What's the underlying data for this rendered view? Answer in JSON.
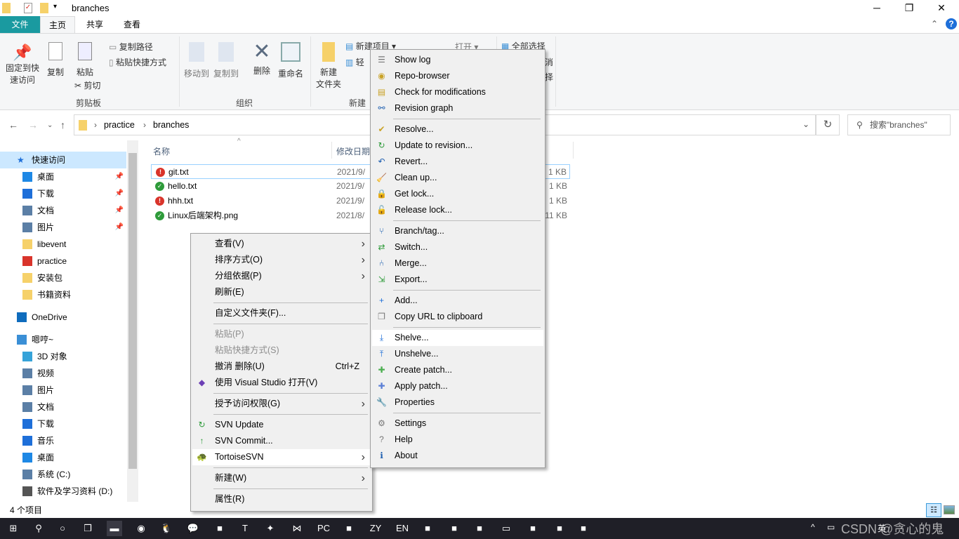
{
  "window": {
    "title": "branches",
    "minimize": "─",
    "maximize": "❐",
    "close": "✕",
    "help": "?",
    "collapse": "⌃"
  },
  "tabs": [
    {
      "label": "文件"
    },
    {
      "label": "主页"
    },
    {
      "label": "共享"
    },
    {
      "label": "查看"
    }
  ],
  "ribbon": {
    "pin": "固定到快",
    "pin2": "速访问",
    "copy": "复制",
    "paste": "粘贴",
    "copy_path": "复制路径",
    "paste_shortcut": "粘贴快捷方式",
    "cut": "剪切",
    "clipboard_group": "剪贴板",
    "move_to": "移动到",
    "copy_to": "复制到",
    "delete": "删除",
    "rename": "重命名",
    "organize_group": "组织",
    "new_folder": "新建",
    "new_folder2": "文件夹",
    "new_item": "新建项目 ▾",
    "easy_access": "轻",
    "new_group": "新建",
    "open": "打开 ▾",
    "select_all": "全部选择",
    "select_none": "消",
    "invert": "择"
  },
  "address": {
    "crumbs": [
      "practice",
      "branches"
    ],
    "search_placeholder": "搜索\"branches\""
  },
  "sidebar": {
    "items": [
      {
        "label": "快速访问",
        "icon": "star-icon",
        "color": "#1e6fd9"
      },
      {
        "label": "桌面",
        "icon": "desktop-icon",
        "color": "#1e88e5",
        "pinned": true
      },
      {
        "label": "下载",
        "icon": "download-icon",
        "color": "#1e6fd9",
        "pinned": true
      },
      {
        "label": "文档",
        "icon": "document-icon",
        "color": "#5b7fa6",
        "pinned": true
      },
      {
        "label": "图片",
        "icon": "pictures-icon",
        "color": "#5b7fa6",
        "pinned": true
      },
      {
        "label": "libevent",
        "icon": "folder-icon",
        "color": "#f6d16a"
      },
      {
        "label": "practice",
        "icon": "svn-conflict-folder-icon",
        "color": "#d9342b"
      },
      {
        "label": "安装包",
        "icon": "folder-icon",
        "color": "#f6d16a"
      },
      {
        "label": "书籍资料",
        "icon": "folder-icon",
        "color": "#f6d16a"
      },
      {
        "label": "OneDrive",
        "icon": "cloud-icon",
        "color": "#0f6cbd"
      },
      {
        "label": "嗯哼~",
        "icon": "computer-icon",
        "color": "#3a8fd6"
      },
      {
        "label": "3D 对象",
        "icon": "cube-icon",
        "color": "#36a3d9"
      },
      {
        "label": "视频",
        "icon": "video-icon",
        "color": "#5b7fa6"
      },
      {
        "label": "图片",
        "icon": "pictures-icon",
        "color": "#5b7fa6"
      },
      {
        "label": "文档",
        "icon": "document-icon",
        "color": "#5b7fa6"
      },
      {
        "label": "下载",
        "icon": "download-icon",
        "color": "#1e6fd9"
      },
      {
        "label": "音乐",
        "icon": "music-icon",
        "color": "#1e6fd9"
      },
      {
        "label": "桌面",
        "icon": "desktop-icon",
        "color": "#1e88e5"
      },
      {
        "label": "系统 (C:)",
        "icon": "drive-icon",
        "color": "#5b7fa6"
      },
      {
        "label": "软件及学习资料 (D:)",
        "icon": "drive-icon",
        "color": "#555"
      }
    ]
  },
  "files": {
    "columns": {
      "name": "名称",
      "date": "修改日期"
    },
    "rows": [
      {
        "name": "git.txt",
        "date": "2021/9/",
        "size": "1 KB",
        "status": "conflict"
      },
      {
        "name": "hello.txt",
        "date": "2021/9/",
        "size": "1 KB",
        "status": "normal"
      },
      {
        "name": "hhh.txt",
        "date": "2021/9/",
        "size": "1 KB",
        "status": "conflict"
      },
      {
        "name": "Linux后端架构.png",
        "date": "2021/8/",
        "size": "11 KB",
        "status": "normal"
      }
    ]
  },
  "status_bar": {
    "count": "4 个项目"
  },
  "context_menu": {
    "items": [
      {
        "label": "查看(V)",
        "arrow": true
      },
      {
        "label": "排序方式(O)",
        "arrow": true
      },
      {
        "label": "分组依据(P)",
        "arrow": true
      },
      {
        "label": "刷新(E)"
      },
      {
        "sep": true
      },
      {
        "label": "自定义文件夹(F)..."
      },
      {
        "sep": true
      },
      {
        "label": "粘贴(P)",
        "disabled": true
      },
      {
        "label": "粘贴快捷方式(S)",
        "disabled": true
      },
      {
        "label": "撤消 删除(U)",
        "key": "Ctrl+Z"
      },
      {
        "label": "使用 Visual Studio 打开(V)",
        "icon": "visual-studio-icon"
      },
      {
        "sep": true
      },
      {
        "label": "授予访问权限(G)",
        "arrow": true
      },
      {
        "sep": true
      },
      {
        "label": "SVN Update",
        "icon": "svn-update-icon"
      },
      {
        "label": "SVN Commit...",
        "icon": "svn-commit-icon"
      },
      {
        "label": "TortoiseSVN",
        "icon": "tortoisesvn-icon",
        "arrow": true,
        "highlighted": true
      },
      {
        "sep": true
      },
      {
        "label": "新建(W)",
        "arrow": true
      },
      {
        "sep": true
      },
      {
        "label": "属性(R)"
      }
    ]
  },
  "svn_menu": {
    "items": [
      {
        "label": "Show log",
        "icon": "log-icon"
      },
      {
        "label": "Repo-browser",
        "icon": "repo-browser-icon"
      },
      {
        "label": "Check for modifications",
        "icon": "check-modifications-icon"
      },
      {
        "label": "Revision graph",
        "icon": "revision-graph-icon"
      },
      {
        "sep": true
      },
      {
        "label": "Resolve...",
        "icon": "resolve-icon"
      },
      {
        "label": "Update to revision...",
        "icon": "update-icon"
      },
      {
        "label": "Revert...",
        "icon": "revert-icon"
      },
      {
        "label": "Clean up...",
        "icon": "broom-icon"
      },
      {
        "label": "Get lock...",
        "icon": "lock-icon"
      },
      {
        "label": "Release lock...",
        "icon": "unlock-icon"
      },
      {
        "sep": true
      },
      {
        "label": "Branch/tag...",
        "icon": "branch-icon"
      },
      {
        "label": "Switch...",
        "icon": "switch-icon"
      },
      {
        "label": "Merge...",
        "icon": "merge-icon"
      },
      {
        "label": "Export...",
        "icon": "export-icon"
      },
      {
        "sep": true
      },
      {
        "label": "Add...",
        "icon": "plus-icon"
      },
      {
        "label": "Copy URL to clipboard",
        "icon": "copy-icon"
      },
      {
        "sep": true
      },
      {
        "label": "Shelve...",
        "icon": "shelve-icon",
        "highlighted": true
      },
      {
        "label": "Unshelve...",
        "icon": "unshelve-icon"
      },
      {
        "label": "Create patch...",
        "icon": "patch-icon"
      },
      {
        "label": "Apply patch...",
        "icon": "apply-patch-icon"
      },
      {
        "label": "Properties",
        "icon": "wrench-icon"
      },
      {
        "sep": true
      },
      {
        "label": "Settings",
        "icon": "settings-icon"
      },
      {
        "label": "Help",
        "icon": "help-icon"
      },
      {
        "label": "About",
        "icon": "info-icon"
      }
    ]
  },
  "taskbar": {
    "apps": [
      "windows-icon",
      "search-icon",
      "cortana-icon",
      "task-view-icon",
      "file-explorer-icon",
      "chrome-icon",
      "qq-icon",
      "wechat-icon",
      "app-icon",
      "typora-icon",
      "xmind-icon",
      "vscode-icon",
      "pycharm-icon",
      "app-icon",
      "zy-icon",
      "en-icon",
      "app-icon",
      "app-icon",
      "app-icon",
      "terminal-icon",
      "app-icon",
      "app-icon",
      "app-icon"
    ],
    "tray": {
      "ime": "英",
      "watermark": "CSDN @贪心的鬼"
    }
  }
}
